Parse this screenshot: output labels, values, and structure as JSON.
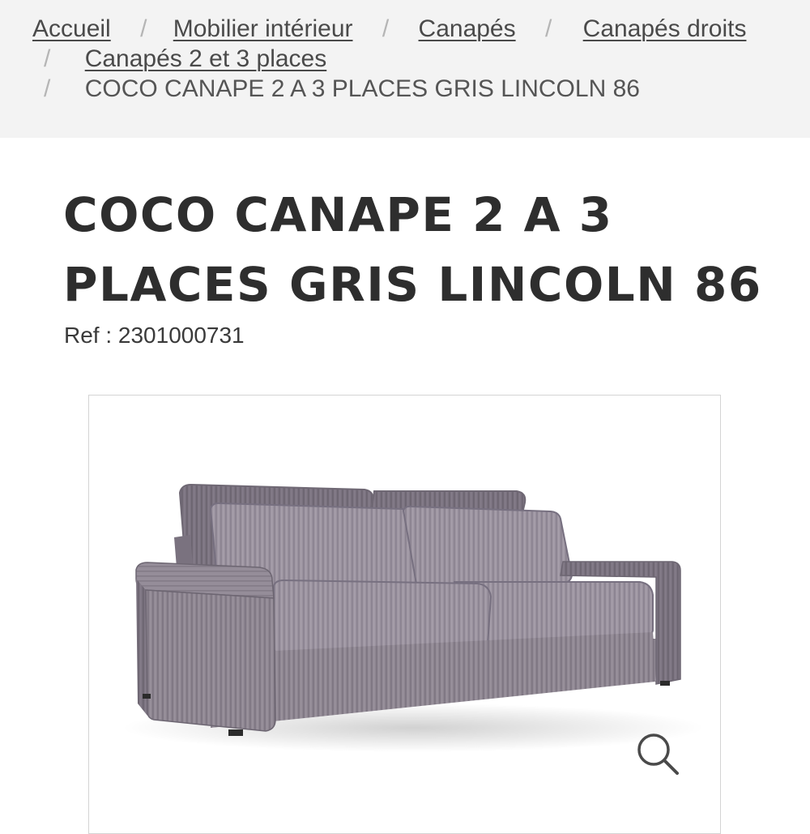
{
  "breadcrumb": {
    "items": [
      {
        "label": "Accueil"
      },
      {
        "label": "Mobilier intérieur"
      },
      {
        "label": "Canapés"
      },
      {
        "label": "Canapés droits"
      },
      {
        "label": "Canapés 2 et 3 places"
      }
    ],
    "current": "COCO CANAPE 2 A 3 PLACES GRIS LINCOLN 86",
    "separator": "/"
  },
  "product": {
    "title_line1": "COCO CANAPE 2 A 3",
    "title_line2": "PLACES GRIS LINCOLN 86",
    "ref": "Ref : 2301000731",
    "image_icon": "sofa-image",
    "zoom_icon": "magnifier-icon"
  },
  "colors": {
    "breadcrumb_bg": "#f3f3f3",
    "title": "#2e2e2e",
    "sofa_fabric": "#8f8792"
  }
}
